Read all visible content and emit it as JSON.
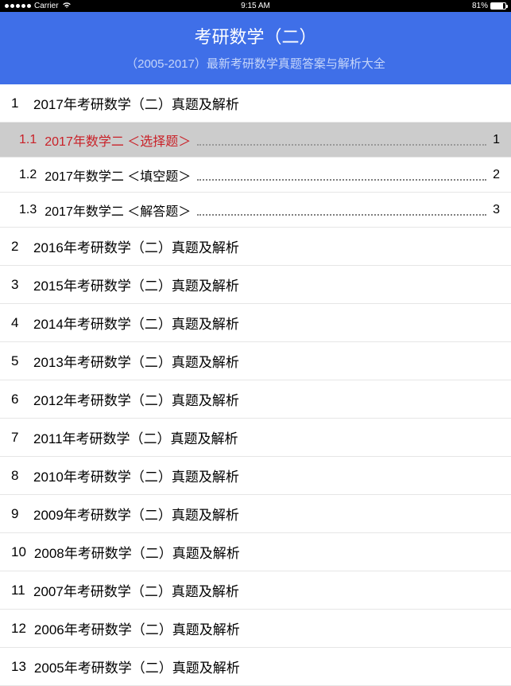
{
  "status_bar": {
    "carrier": "Carrier",
    "time": "9:15 AM",
    "battery_pct": "81%"
  },
  "header": {
    "title": "考研数学（二）",
    "subtitle": "（2005-2017）最新考研数学真题答案与解析大全"
  },
  "chapters": [
    {
      "num": "1",
      "title": "2017年考研数学（二）真题及解析",
      "expanded": true,
      "subs": [
        {
          "num": "1.1",
          "title": "2017年数学二 ＜选择题＞",
          "page": "1",
          "selected": true
        },
        {
          "num": "1.2",
          "title": "2017年数学二 ＜填空题＞",
          "page": "2",
          "selected": false
        },
        {
          "num": "1.3",
          "title": "2017年数学二 ＜解答题＞",
          "page": "3",
          "selected": false
        }
      ]
    },
    {
      "num": "2",
      "title": "2016年考研数学（二）真题及解析"
    },
    {
      "num": "3",
      "title": "2015年考研数学（二）真题及解析"
    },
    {
      "num": "4",
      "title": "2014年考研数学（二）真题及解析"
    },
    {
      "num": "5",
      "title": "2013年考研数学（二）真题及解析"
    },
    {
      "num": "6",
      "title": "2012年考研数学（二）真题及解析"
    },
    {
      "num": "7",
      "title": "2011年考研数学（二）真题及解析"
    },
    {
      "num": "8",
      "title": "2010年考研数学（二）真题及解析"
    },
    {
      "num": "9",
      "title": "2009年考研数学（二）真题及解析"
    },
    {
      "num": "10",
      "title": "2008年考研数学（二）真题及解析"
    },
    {
      "num": "11",
      "title": "2007年考研数学（二）真题及解析"
    },
    {
      "num": "12",
      "title": "2006年考研数学（二）真题及解析"
    },
    {
      "num": "13",
      "title": "2005年考研数学（二）真题及解析"
    }
  ]
}
